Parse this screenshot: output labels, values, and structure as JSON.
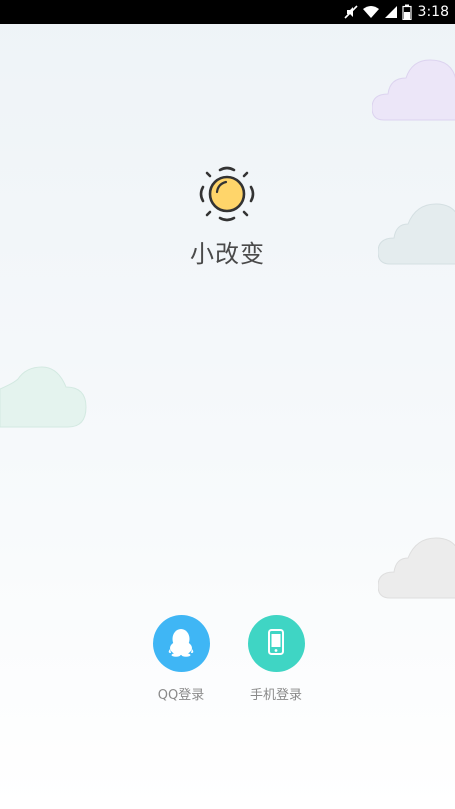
{
  "status_bar": {
    "time": "3:18",
    "icons": [
      "muted-icon",
      "wifi-icon",
      "signal-icon",
      "battery-icon"
    ]
  },
  "app": {
    "title": "小改变",
    "logo_icon": "sun-icon"
  },
  "login": {
    "qq": {
      "label": "QQ登录",
      "icon": "qq-penguin-icon",
      "color": "#3fb6f5"
    },
    "phone": {
      "label": "手机登录",
      "icon": "phone-icon",
      "color": "#3fd5c4"
    }
  },
  "colors": {
    "sun_fill": "#ffd56a",
    "cloud_purple": "#ece6f8",
    "cloud_teal": "#e4ecee",
    "cloud_green": "#e4f3ee",
    "cloud_gray": "#ececec"
  }
}
